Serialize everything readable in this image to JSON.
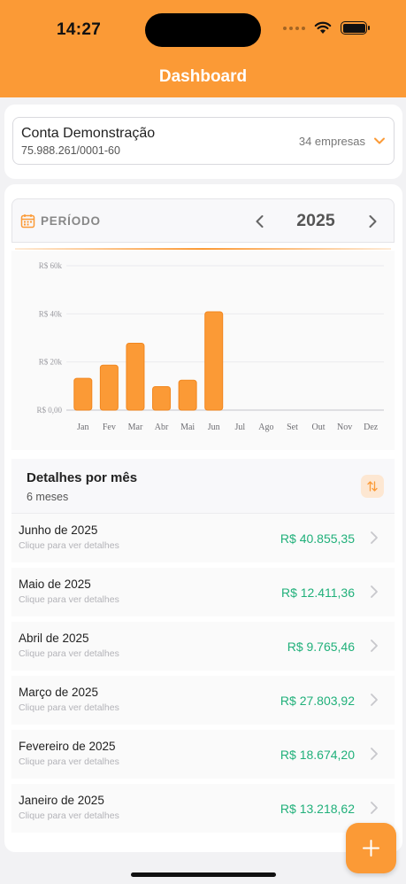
{
  "status_bar": {
    "time": "14:27"
  },
  "header": {
    "title": "Dashboard"
  },
  "account": {
    "name": "Conta Demonstração",
    "document": "75.988.261/0001-60",
    "companies": "34 empresas"
  },
  "period": {
    "label": "PERÍODO",
    "year": "2025"
  },
  "chart_data": {
    "type": "bar",
    "categories": [
      "Jan",
      "Fev",
      "Mar",
      "Abr",
      "Mai",
      "Jun",
      "Jul",
      "Ago",
      "Set",
      "Out",
      "Nov",
      "Dez"
    ],
    "values": [
      13218.62,
      18674.2,
      27803.92,
      9765.46,
      12411.36,
      40855.35,
      0,
      0,
      0,
      0,
      0,
      0
    ],
    "y_ticks": [
      "R$ 0,00",
      "R$ 20k",
      "R$ 40k",
      "R$ 60k"
    ],
    "ylim": [
      0,
      60000
    ],
    "grid": true,
    "color": "#fb9a36"
  },
  "details": {
    "title": "Detalhes por mês",
    "subtitle": "6 meses",
    "months": [
      {
        "name": "Junho de 2025",
        "hint": "Clique para ver detalhes",
        "value": "R$ 40.855,35"
      },
      {
        "name": "Maio de 2025",
        "hint": "Clique para ver detalhes",
        "value": "R$ 12.411,36"
      },
      {
        "name": "Abril de 2025",
        "hint": "Clique para ver detalhes",
        "value": "R$ 9.765,46"
      },
      {
        "name": "Março de 2025",
        "hint": "Clique para ver detalhes",
        "value": "R$ 27.803,92"
      },
      {
        "name": "Fevereiro de 2025",
        "hint": "Clique para ver detalhes",
        "value": "R$ 18.674,20"
      },
      {
        "name": "Janeiro de 2025",
        "hint": "Clique para ver detalhes",
        "value": "R$ 13.218,62"
      }
    ]
  },
  "colors": {
    "brand": "#fb9a36",
    "positive": "#20b07a"
  },
  "icons": [
    "wifi-icon",
    "battery-icon",
    "chevron-down-icon",
    "calendar-icon",
    "chevron-left-icon",
    "chevron-right-icon",
    "sort-icon",
    "plus-icon"
  ]
}
